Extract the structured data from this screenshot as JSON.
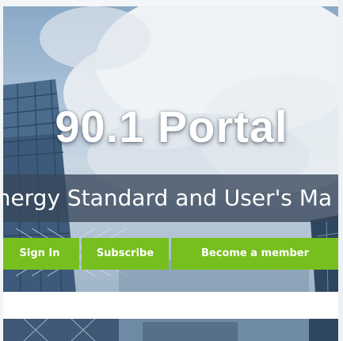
{
  "hero": {
    "title": "90.1 Portal",
    "subtitle": "Energy Standard and User's Ma"
  },
  "actions": {
    "sign_in_label": "Sign In",
    "subscribe_label": "Subscribe",
    "member_label": "Become a member"
  },
  "colors": {
    "accent_green": "#77bf1f",
    "subtitle_bar": "#37465a",
    "title_text": "#ffffff"
  }
}
